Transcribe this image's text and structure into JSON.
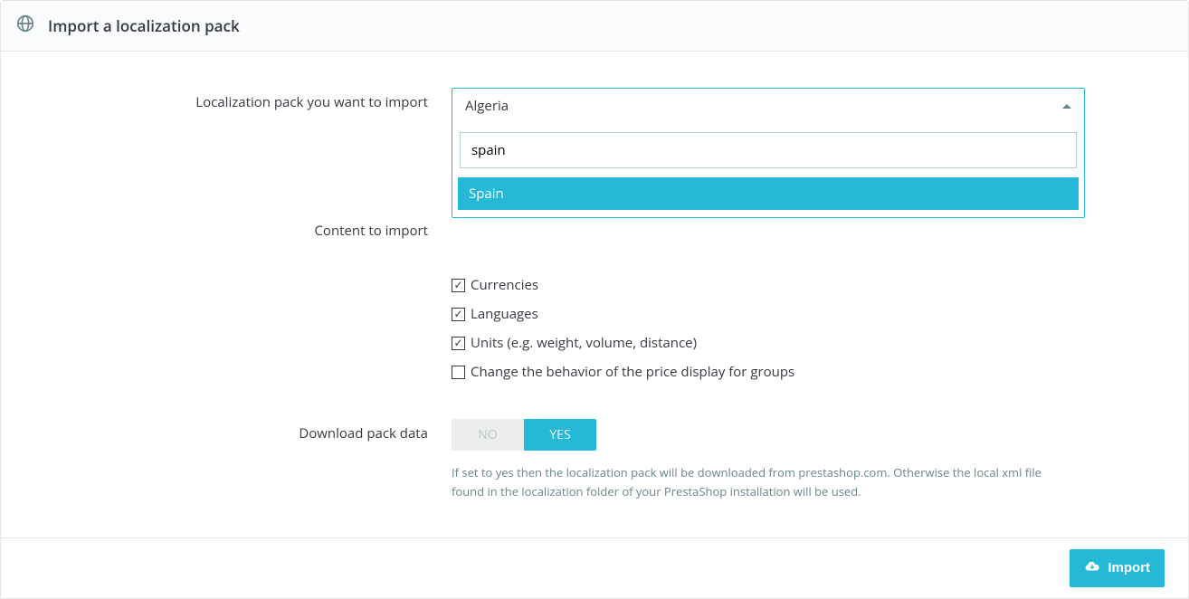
{
  "header": {
    "title": "Import a localization pack"
  },
  "form": {
    "pack_label": "Localization pack you want to import",
    "selected_pack": "Algeria",
    "search_value": "spain",
    "search_result": "Spain",
    "content_label": "Content to import",
    "checkboxes": {
      "currencies": {
        "label": "Currencies",
        "checked": true
      },
      "languages": {
        "label": "Languages",
        "checked": true
      },
      "units": {
        "label": "Units (e.g. weight, volume, distance)",
        "checked": true
      },
      "price_display": {
        "label": "Change the behavior of the price display for groups",
        "checked": false
      }
    },
    "download_label": "Download pack data",
    "toggle": {
      "no": "NO",
      "yes": "YES",
      "value": "YES"
    },
    "download_help": "If set to yes then the localization pack will be downloaded from prestashop.com. Otherwise the local xml file found in the localization folder of your PrestaShop installation will be used."
  },
  "footer": {
    "import_label": "Import"
  }
}
